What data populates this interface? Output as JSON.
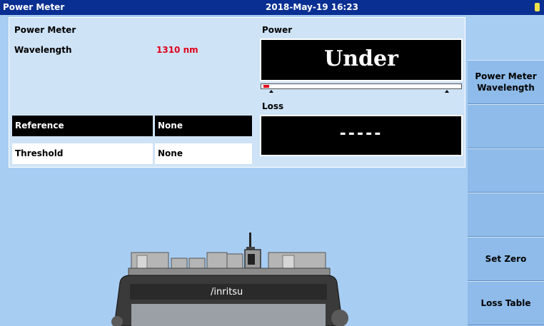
{
  "titlebar": {
    "app_name": "Power Meter",
    "datetime": "2018-May-19 16:23"
  },
  "panel": {
    "title": "Power Meter",
    "wavelength_label": "Wavelength",
    "wavelength_value": "1310 nm",
    "power_label": "Power",
    "power_display": "Under",
    "loss_label": "Loss",
    "loss_display": "-----",
    "reference_label": "Reference",
    "reference_value": "None",
    "threshold_label": "Threshold",
    "threshold_value": "None",
    "power_bar_fraction": 0.03
  },
  "softkeys": [
    {
      "label": "Power Meter\nWavelength"
    },
    {
      "label": ""
    },
    {
      "label": ""
    },
    {
      "label": ""
    },
    {
      "label": "Set Zero"
    },
    {
      "label": "Loss Table"
    }
  ],
  "device": {
    "brand": "/inritsu"
  },
  "colors": {
    "titlebar": "#0a2f93",
    "background": "#a8cdf2",
    "accent_red": "#e0001a"
  }
}
